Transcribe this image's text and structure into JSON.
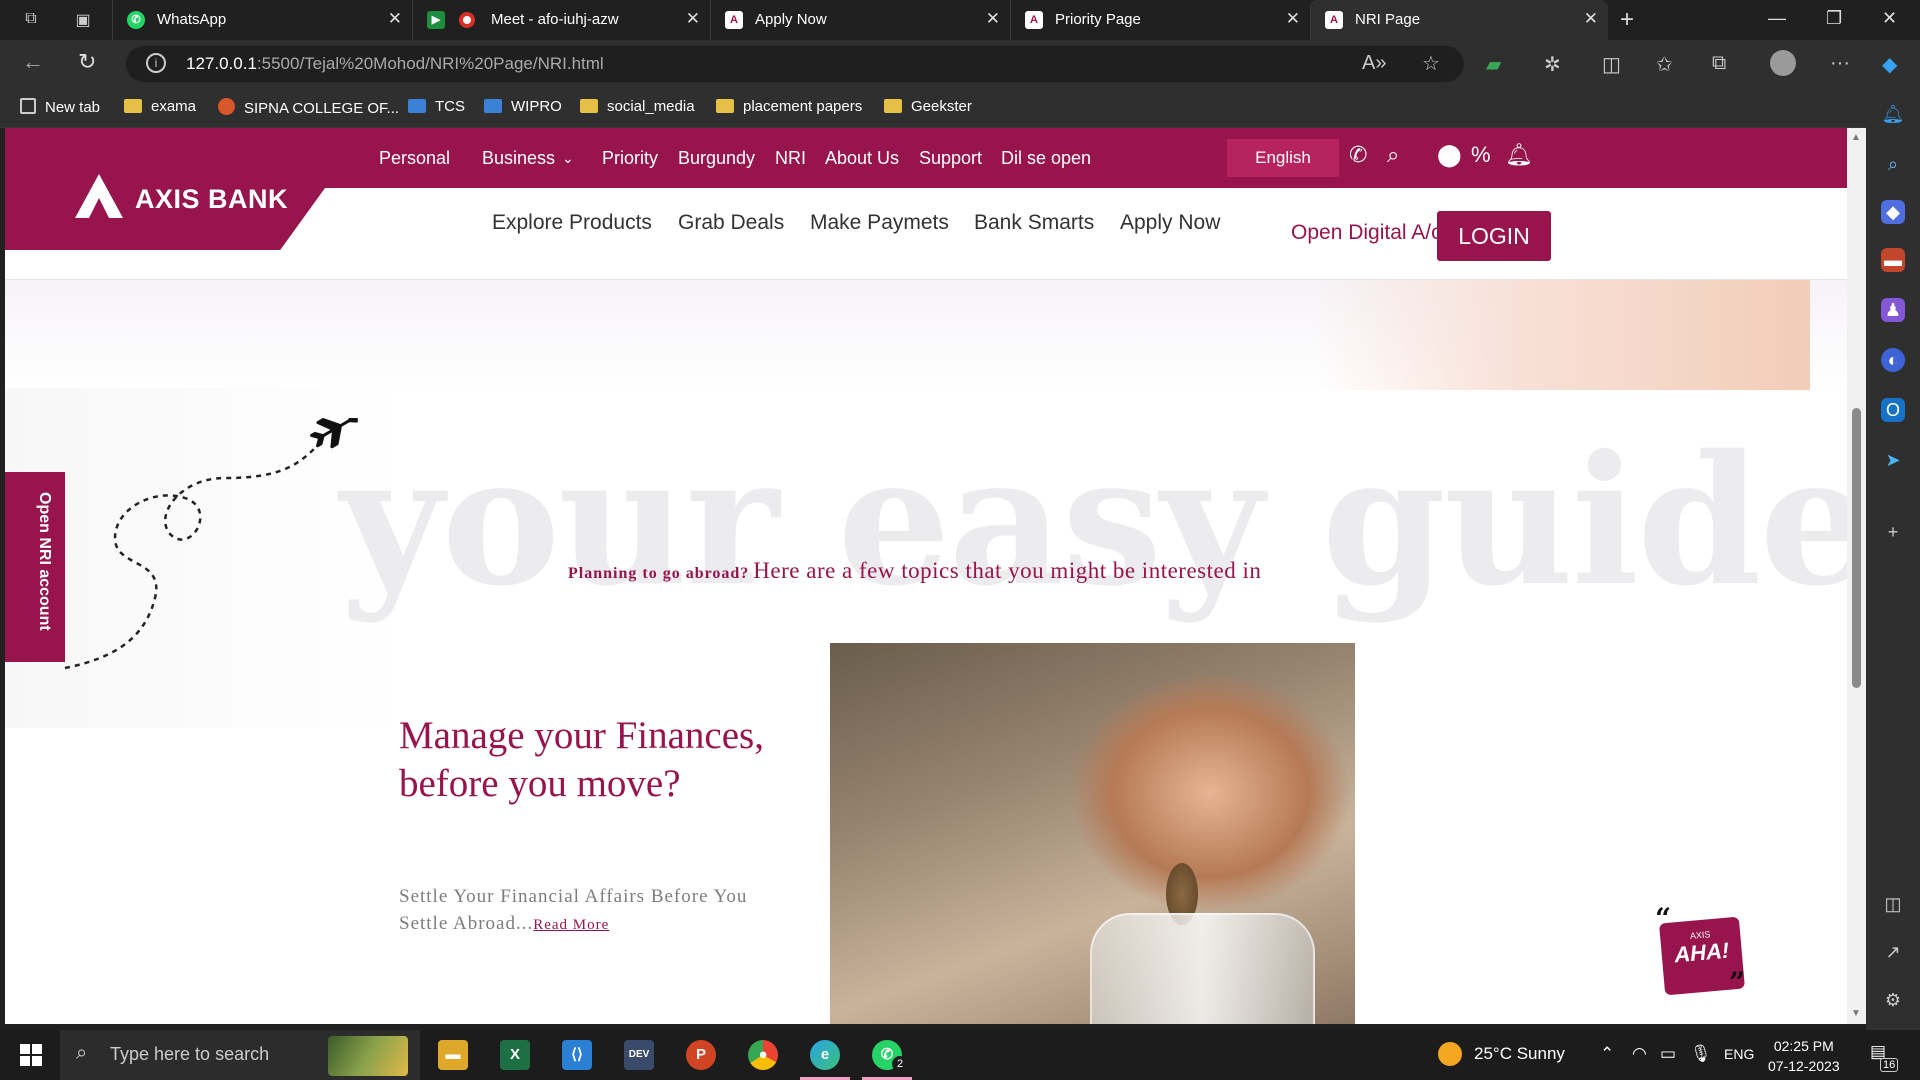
{
  "browser": {
    "tabs": [
      {
        "label": "WhatsApp"
      },
      {
        "label": "Meet - afo-iuhj-azw"
      },
      {
        "label": "Apply Now"
      },
      {
        "label": "Priority Page"
      },
      {
        "label": "NRI Page"
      }
    ],
    "url_host": "127.0.0.1",
    "url_rest": ":5500/Tejal%20Mohod/NRI%20Page/NRI.html",
    "bookmarks": [
      "New tab",
      "exama",
      "SIPNA COLLEGE OF...",
      "TCS",
      "WIPRO",
      "social_media",
      "placement papers",
      "Geekster"
    ]
  },
  "site": {
    "topnav": [
      "Personal",
      "Business",
      "Priority",
      "Burgundy",
      "NRI",
      "About Us",
      "Support",
      "Dil se open"
    ],
    "language": "English",
    "logo": "AXIS BANK",
    "secnav": [
      "Explore Products",
      "Grab Deals",
      "Make Paymets",
      "Bank Smarts",
      "Apply Now"
    ],
    "open_digital": "Open Digital A/c",
    "login": "LOGIN",
    "hero_watermark": "your easy guide",
    "tagline_small": "Planning to go abroad?",
    "tagline_big": "Here are a few topics that you might be interested in",
    "side_tab": "Open NRI account",
    "section_heading": "Manage your Finances, before you move?",
    "section_desc": "Settle Your Financial Affairs Before You Settle Abroad...",
    "read_more": "Read More",
    "aha_small": "AXIS",
    "aha_big": "AHA!",
    "brand_color": "#97144d"
  },
  "taskbar": {
    "search_placeholder": "Type here to search",
    "weather": "25°C  Sunny",
    "lang": "ENG",
    "time": "02:25 PM",
    "date": "07-12-2023",
    "notif_count": "16",
    "whatsapp_badge": "2"
  }
}
